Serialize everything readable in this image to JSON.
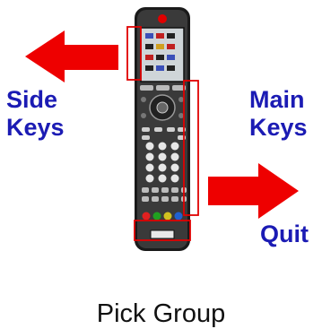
{
  "labels": {
    "side_keys": [
      "Side",
      "Keys"
    ],
    "main_keys": [
      "Main",
      "Keys"
    ],
    "quit": "Quit",
    "footer": "Pick Group"
  },
  "screen_buttons": [
    "",
    "",
    ""
  ],
  "colors": {
    "label": "#1b1bb4",
    "arrow": "#ee0000",
    "highlight": "#e00000",
    "remote_body": "#1a1a1a"
  }
}
